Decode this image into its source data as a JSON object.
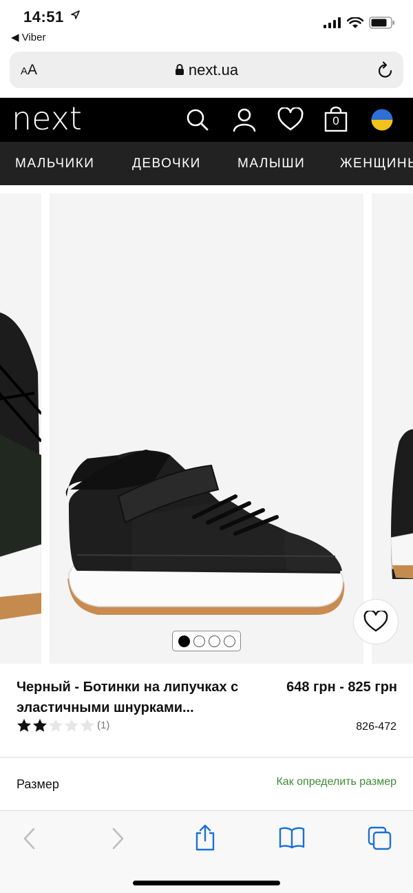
{
  "status": {
    "time": "14:51",
    "back_app": "◀ Viber"
  },
  "browser": {
    "text_size": "AA",
    "host": "next.ua"
  },
  "header": {
    "logo": "next",
    "bag_count": "0"
  },
  "nav": {
    "items": [
      "МАЛЬЧИКИ",
      "ДЕВОЧКИ",
      "МАЛЫШИ",
      "ЖЕНЩИНЫ"
    ]
  },
  "gallery": {
    "total_images": 4,
    "active_index": 1
  },
  "product": {
    "title": "Черный - Ботинки на липучках с эластичными шнурками...",
    "price": "648 грн - 825 грн",
    "rating_value": 2,
    "rating_max": 5,
    "rating_count": "(1)",
    "sku": "826-472"
  },
  "size": {
    "label": "Размер",
    "guide_link": "Как определить размер"
  },
  "colors": {
    "header_bg": "#000000",
    "nav_bg": "#222222",
    "link_green": "#3d8a35",
    "ios_blue": "#1a6fd8"
  }
}
